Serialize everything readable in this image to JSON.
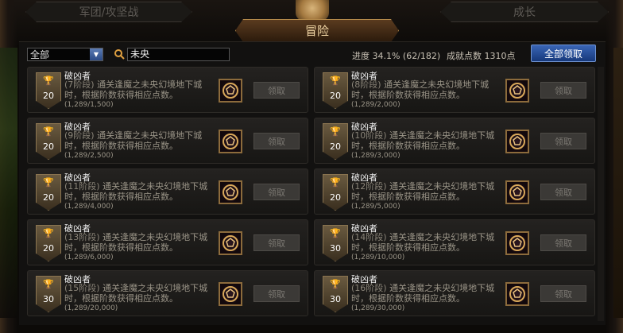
{
  "tabs": {
    "left": "军团/攻坚战",
    "active": "冒险",
    "right": "成长"
  },
  "filter": {
    "selected": "全部",
    "search_value": "未央"
  },
  "stats": {
    "progress": "进度  34.1% (62/182)",
    "points": "成就点数 1310点"
  },
  "claim_all_label": "全部领取",
  "achievements": [
    {
      "title": "破凶者",
      "stage": "(7阶段)",
      "desc": " 通关逢魔之未央幻境地下城时，根据阶数获得相应点数。",
      "progress": "(1,289/1,500)",
      "points": "20",
      "button": "领取"
    },
    {
      "title": "破凶者",
      "stage": "(8阶段)",
      "desc": " 通关逢魔之未央幻境地下城时，根据阶数获得相应点数。",
      "progress": "(1,289/2,000)",
      "points": "20",
      "button": "领取"
    },
    {
      "title": "破凶者",
      "stage": "(9阶段)",
      "desc": " 通关逢魔之未央幻境地下城时，根据阶数获得相应点数。",
      "progress": "(1,289/2,500)",
      "points": "20",
      "button": "领取"
    },
    {
      "title": "破凶者",
      "stage": "(10阶段)",
      "desc": " 通关逢魔之未央幻境地下城时，根据阶数获得相应点数。",
      "progress": "(1,289/3,000)",
      "points": "20",
      "button": "领取"
    },
    {
      "title": "破凶者",
      "stage": "(11阶段)",
      "desc": " 通关逢魔之未央幻境地下城时，根据阶数获得相应点数。",
      "progress": "(1,289/4,000)",
      "points": "20",
      "button": "领取"
    },
    {
      "title": "破凶者",
      "stage": "(12阶段)",
      "desc": " 通关逢魔之未央幻境地下城时，根据阶数获得相应点数。",
      "progress": "(1,289/5,000)",
      "points": "20",
      "button": "领取"
    },
    {
      "title": "破凶者",
      "stage": "(13阶段)",
      "desc": " 通关逢魔之未央幻境地下城时，根据阶数获得相应点数。",
      "progress": "(1,289/6,000)",
      "points": "20",
      "button": "领取"
    },
    {
      "title": "破凶者",
      "stage": "(14阶段)",
      "desc": " 通关逢魔之未央幻境地下城时，根据阶数获得相应点数。",
      "progress": "(1,289/10,000)",
      "points": "30",
      "button": "领取"
    },
    {
      "title": "破凶者",
      "stage": "(15阶段)",
      "desc": " 通关逢魔之未央幻境地下城时，根据阶数获得相应点数。",
      "progress": "(1,289/20,000)",
      "points": "30",
      "button": "领取"
    },
    {
      "title": "破凶者",
      "stage": "(16阶段)",
      "desc": " 通关逢魔之未央幻境地下城时，根据阶数获得相应点数。",
      "progress": "(1,289/30,000)",
      "points": "30",
      "button": "领取"
    }
  ],
  "icons": {
    "select_arrow": "chevron-down-icon",
    "search": "search-icon",
    "trophy": "trophy-icon",
    "reward": "emblem-icon"
  },
  "colors": {
    "accent_gold": "#b58b4c",
    "claim_all_blue": "#2a55a0"
  }
}
